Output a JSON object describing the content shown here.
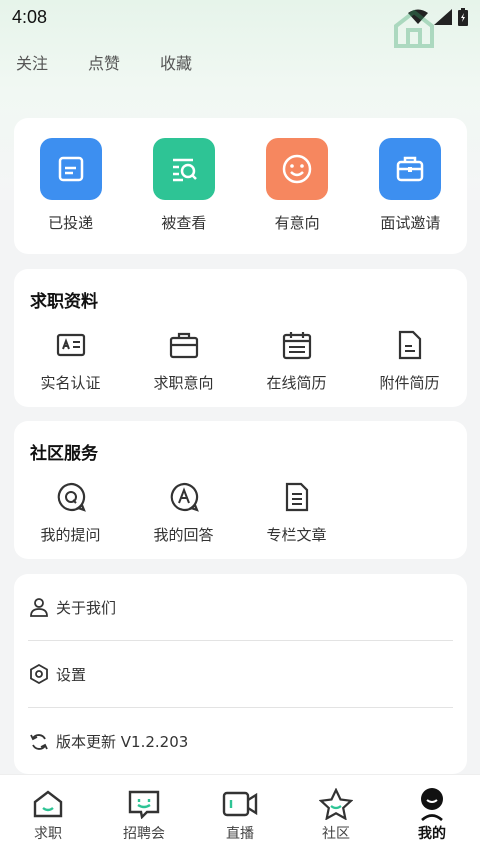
{
  "status_bar": {
    "time": "4:08"
  },
  "top_tabs": [
    {
      "label": "关注"
    },
    {
      "label": "点赞"
    },
    {
      "label": "收藏"
    }
  ],
  "quick_actions": [
    {
      "label": "已投递",
      "icon": "document-icon",
      "color": "#3d8ff0"
    },
    {
      "label": "被查看",
      "icon": "search-document-icon",
      "color": "#2ec495"
    },
    {
      "label": "有意向",
      "icon": "smile-icon",
      "color": "#f6875f"
    },
    {
      "label": "面试邀请",
      "icon": "briefcase-icon",
      "color": "#3d8ff0"
    }
  ],
  "job_profile": {
    "title": "求职资料",
    "items": [
      {
        "label": "实名认证",
        "icon": "id-card-icon"
      },
      {
        "label": "求职意向",
        "icon": "briefcase-icon"
      },
      {
        "label": "在线简历",
        "icon": "calendar-resume-icon"
      },
      {
        "label": "附件简历",
        "icon": "file-icon"
      }
    ]
  },
  "community": {
    "title": "社区服务",
    "items": [
      {
        "label": "我的提问",
        "icon": "question-bubble-icon"
      },
      {
        "label": "我的回答",
        "icon": "answer-bubble-icon"
      },
      {
        "label": "专栏文章",
        "icon": "article-icon"
      }
    ]
  },
  "menu": [
    {
      "label": "关于我们",
      "icon": "user-icon"
    },
    {
      "label": "设置",
      "icon": "settings-icon"
    },
    {
      "label": "版本更新 V1.2.203",
      "icon": "refresh-icon"
    }
  ],
  "bottom_nav": [
    {
      "label": "求职",
      "icon": "home-icon"
    },
    {
      "label": "招聘会",
      "icon": "chat-smile-icon"
    },
    {
      "label": "直播",
      "icon": "video-icon"
    },
    {
      "label": "社区",
      "icon": "star-icon"
    },
    {
      "label": "我的",
      "icon": "profile-icon",
      "active": true
    }
  ],
  "colors": {
    "accent_green": "#2ec495",
    "blue": "#3d8ff0",
    "orange": "#f6875f"
  }
}
